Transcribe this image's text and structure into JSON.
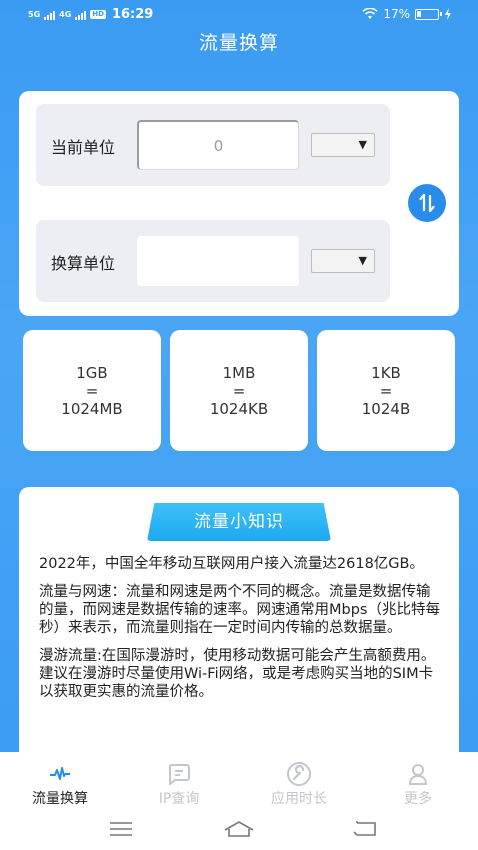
{
  "status_bar": {
    "left_signal_1": "5G",
    "left_signal_2": "4G",
    "hd_badge": "HD",
    "time": "16:29",
    "battery_percent": "17%"
  },
  "header": {
    "title": "流量换算"
  },
  "converter": {
    "current_unit_label": "当前单位",
    "current_value_placeholder": "0",
    "target_unit_label": "换算单位",
    "target_value": ""
  },
  "info_cards": [
    {
      "line1": "1GB",
      "line2": "=",
      "line3": "1024MB"
    },
    {
      "line1": "1MB",
      "line2": "=",
      "line3": "1024KB"
    },
    {
      "line1": "1KB",
      "line2": "=",
      "line3": "1024B"
    }
  ],
  "knowledge": {
    "title": "流量小知识",
    "paragraphs": [
      "2022年，中国全年移动互联网用户接入流量达2618亿GB。",
      "流量与网速：流量和网速是两个不同的概念。流量是数据传输的量，而网速是数据传输的速率。网速通常用Mbps（兆比特每秒）来表示，而流量则指在一定时间内传输的总数据量。",
      "漫游流量:在国际漫游时，使用移动数据可能会产生高额费用。建议在漫游时尽量使用Wi-Fi网络，或是考虑购买当地的SIM卡以获取更实惠的流量价格。"
    ]
  },
  "tabs": [
    {
      "label": "流量换算",
      "icon": "pulse-icon",
      "active": true
    },
    {
      "label": "IP查询",
      "icon": "chat-lines-icon",
      "active": false
    },
    {
      "label": "应用时长",
      "icon": "wrench-icon",
      "active": false
    },
    {
      "label": "更多",
      "icon": "user-icon",
      "active": false
    }
  ],
  "colors": {
    "brand_blue": "#3a9bf2",
    "swap_button": "#2a8cea",
    "title_pill": "#1ea8ef",
    "inactive_tab": "#c3c6cc"
  }
}
